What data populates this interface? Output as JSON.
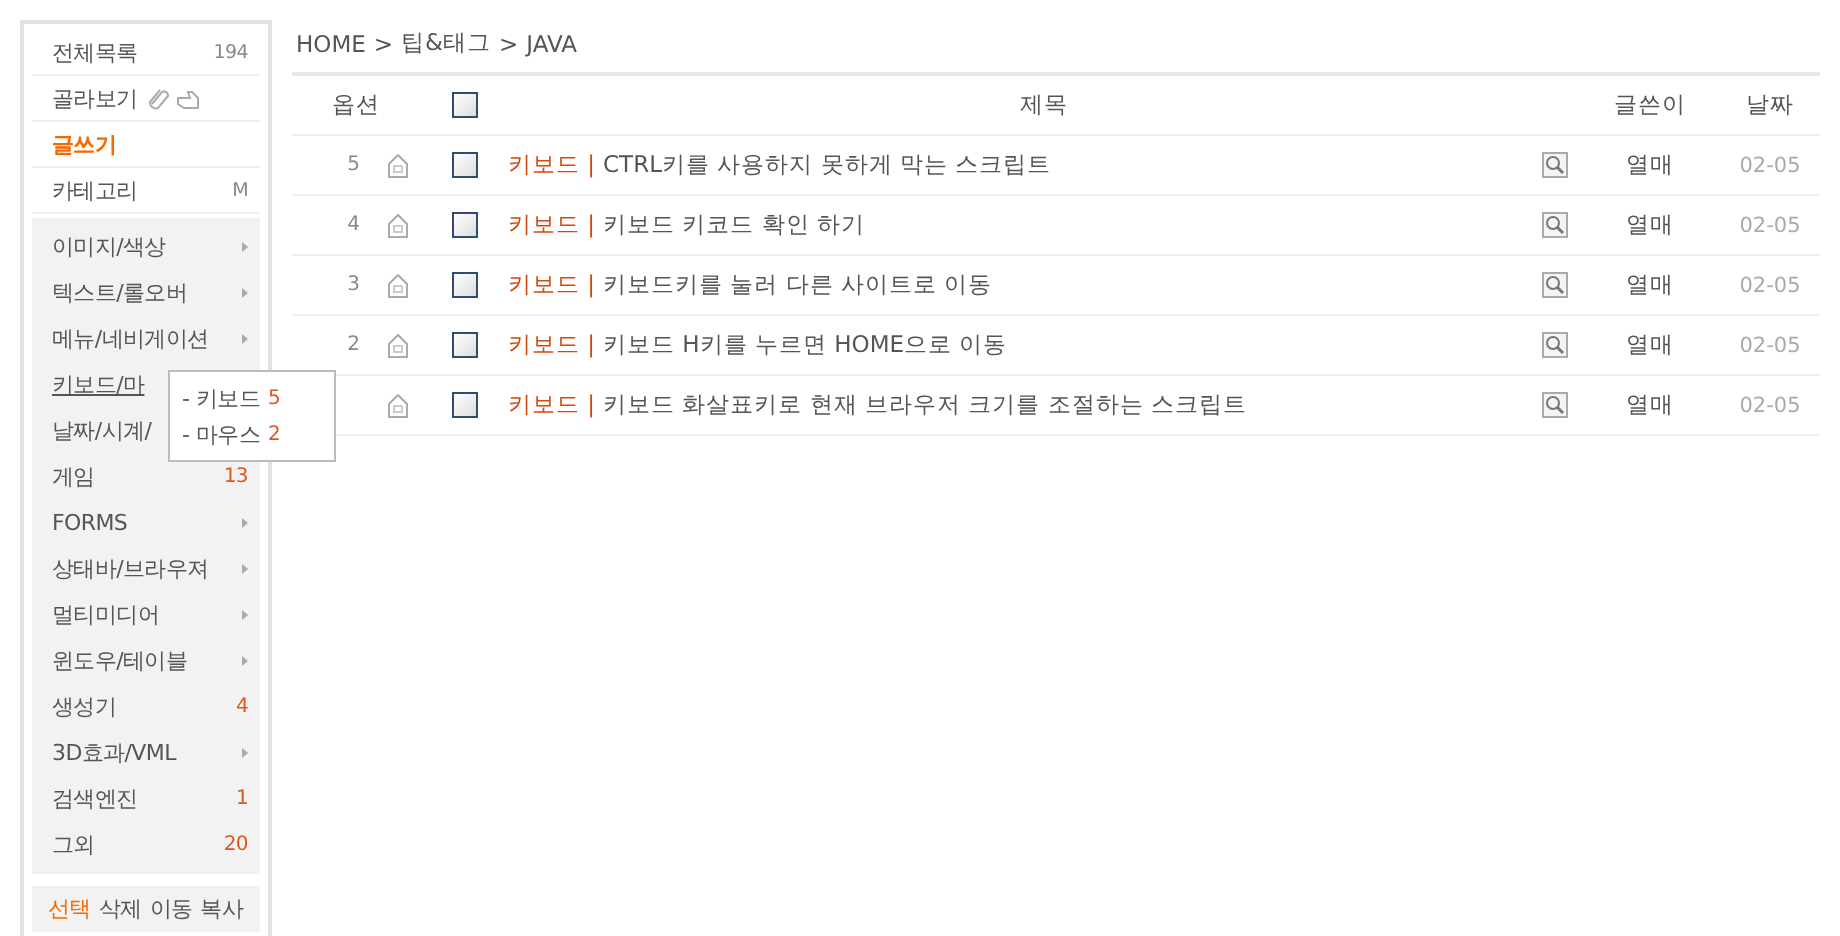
{
  "sidebar": {
    "top_items": [
      {
        "label": "전체목록",
        "kind": "badge",
        "badge": "194"
      },
      {
        "label": "골라보기",
        "kind": "icons"
      },
      {
        "label": "글쓰기",
        "kind": "emphasis"
      },
      {
        "label": "카테고리",
        "kind": "badge",
        "badge": "M"
      }
    ],
    "categories": [
      {
        "label": "이미지/색상",
        "kind": "submenu"
      },
      {
        "label": "텍스트/롤오버",
        "kind": "submenu"
      },
      {
        "label": "메뉴/네비게이션",
        "kind": "submenu"
      },
      {
        "label": "키보드/마",
        "kind": "open",
        "selected": true
      },
      {
        "label": "날짜/시계/",
        "kind": "plain"
      },
      {
        "label": "게임",
        "kind": "count",
        "count": "13"
      },
      {
        "label": "FORMS",
        "kind": "submenu"
      },
      {
        "label": "상태바/브라우져",
        "kind": "submenu"
      },
      {
        "label": "멀티미디어",
        "kind": "submenu"
      },
      {
        "label": "윈도우/테이블",
        "kind": "submenu"
      },
      {
        "label": "생성기",
        "kind": "count",
        "count": "4"
      },
      {
        "label": "3D효과/VML",
        "kind": "submenu"
      },
      {
        "label": "검색엔진",
        "kind": "count",
        "count": "1"
      },
      {
        "label": "그외",
        "kind": "count",
        "count": "20"
      }
    ],
    "actions": [
      {
        "label": "선택",
        "selected": true
      },
      {
        "label": "삭제",
        "selected": false
      },
      {
        "label": "이동",
        "selected": false
      },
      {
        "label": "복사",
        "selected": false
      }
    ]
  },
  "popup_menu": {
    "items": [
      {
        "label": "- 키보드",
        "count": "5"
      },
      {
        "label": "- 마우스",
        "count": "2"
      }
    ]
  },
  "breadcrumb": [
    "HOME",
    "팁&태그",
    "JAVA"
  ],
  "breadcrumb_separator": ">",
  "table": {
    "columns": [
      "옵션",
      "제목",
      "글쓴이",
      "날짜"
    ],
    "select_all": {
      "checked": false
    },
    "rows": [
      {
        "number": "5",
        "category": "키보드 |",
        "title": "CTRL키를 사용하지 못하게 막는 스크립트",
        "author": "열매",
        "date": "02-05",
        "checked": false
      },
      {
        "number": "4",
        "category": "키보드 |",
        "title": "키보드 키코드 확인 하기",
        "author": "열매",
        "date": "02-05",
        "checked": false
      },
      {
        "number": "3",
        "category": "키보드 |",
        "title": "키보드키를 눌러 다른 사이트로 이동",
        "author": "열매",
        "date": "02-05",
        "checked": false
      },
      {
        "number": "2",
        "category": "키보드 |",
        "title": "키보드 H키를 누르면 HOME으로 이동",
        "author": "열매",
        "date": "02-05",
        "checked": false
      },
      {
        "category": "키보드 |",
        "title": "키보드 화살표키로 현재 브라우저 크기를 조절하는 스크립트",
        "author": "열매",
        "date": "02-05",
        "checked": false
      }
    ]
  }
}
